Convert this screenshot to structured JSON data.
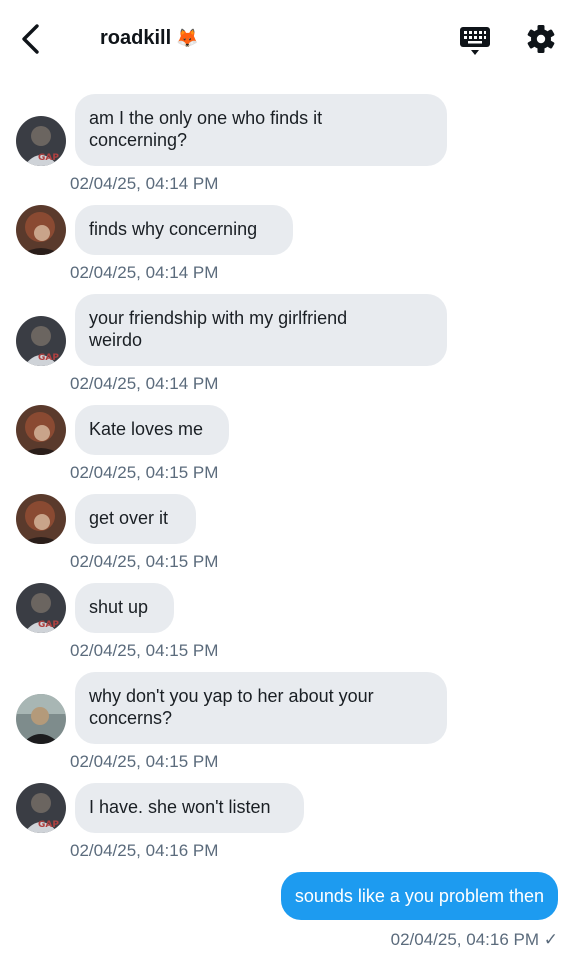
{
  "header": {
    "title": "roadkill",
    "title_emoji": "🦊",
    "back_icon": "chevron-left-icon",
    "keyboard_icon": "keyboard-icon",
    "settings_icon": "gear-icon"
  },
  "messages": [
    {
      "sender": "other-a",
      "text_lines": [
        "am I the only one who finds it",
        "concerning?"
      ],
      "time": "02/04/25, 04:14 PM"
    },
    {
      "sender": "other-b",
      "text_lines": [
        "finds why concerning"
      ],
      "time": "02/04/25, 04:14 PM"
    },
    {
      "sender": "other-a",
      "text_lines": [
        "your friendship with my girlfriend",
        "weirdo"
      ],
      "time": "02/04/25, 04:14 PM"
    },
    {
      "sender": "other-b",
      "text_lines": [
        "Kate loves me"
      ],
      "time": "02/04/25, 04:15 PM"
    },
    {
      "sender": "other-b",
      "text_lines": [
        "get over it"
      ],
      "time": "02/04/25, 04:15 PM"
    },
    {
      "sender": "other-a",
      "text_lines": [
        "shut up"
      ],
      "time": "02/04/25, 04:15 PM"
    },
    {
      "sender": "other-c",
      "text_lines": [
        "why don't you yap to her about your",
        "concerns?"
      ],
      "time": "02/04/25, 04:15 PM"
    },
    {
      "sender": "other-a",
      "text_lines": [
        "I have. she won't listen"
      ],
      "time": "02/04/25, 04:16 PM"
    }
  ],
  "outgoing": {
    "text": "sounds like a you problem then",
    "time": "02/04/25, 04:16 PM",
    "status_mark": "✓"
  },
  "colors": {
    "incoming_bubble": "#e8ebef",
    "outgoing_bubble": "#1d9bf0",
    "timestamp": "#5b6b7c"
  }
}
